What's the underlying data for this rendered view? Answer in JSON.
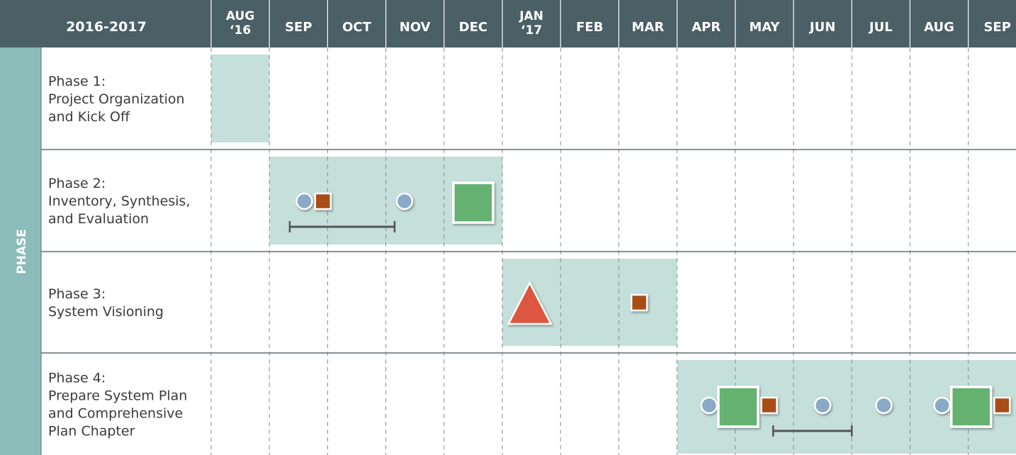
{
  "header": {
    "period_label": "2016-2017",
    "months": [
      [
        "AUG",
        "‘16"
      ],
      [
        "SEP"
      ],
      [
        "OCT"
      ],
      [
        "NOV"
      ],
      [
        "DEC"
      ],
      [
        "JAN",
        "‘17"
      ],
      [
        "FEB"
      ],
      [
        "MAR"
      ],
      [
        "APR"
      ],
      [
        "MAY"
      ],
      [
        "JUN"
      ],
      [
        "JUL"
      ],
      [
        "AUG"
      ],
      [
        "SEP"
      ]
    ]
  },
  "side_label": "PHASE",
  "phases": [
    {
      "lines": [
        "Phase 1:",
        "Project Organization",
        "and Kick Off"
      ],
      "bar": {
        "start": 0,
        "end": 1
      },
      "markers": []
    },
    {
      "lines": [
        "Phase 2:",
        "Inventory, Synthesis,",
        "and Evaluation"
      ],
      "bar": {
        "start": 1,
        "end": 5
      },
      "markers": [
        {
          "type": "circle",
          "month": 1.6
        },
        {
          "type": "small-square",
          "month": 1.92
        },
        {
          "type": "circle",
          "month": 3.32
        },
        {
          "type": "large-square",
          "month": 4.5
        },
        {
          "type": "range",
          "start": 1.35,
          "end": 3.15
        }
      ]
    },
    {
      "lines": [
        "Phase 3:",
        "System Visioning"
      ],
      "bar": {
        "start": 5,
        "end": 8
      },
      "markers": [
        {
          "type": "triangle",
          "month": 5.47
        },
        {
          "type": "small-square",
          "month": 7.35
        }
      ]
    },
    {
      "lines": [
        "Phase 4:",
        "Prepare System Plan",
        "and Comprehensive",
        "Plan Chapter"
      ],
      "bar": {
        "start": 8,
        "end": 14
      },
      "markers": [
        {
          "type": "circle",
          "month": 8.55
        },
        {
          "type": "large-square",
          "month": 9.05
        },
        {
          "type": "small-square",
          "month": 9.58
        },
        {
          "type": "circle",
          "month": 10.5
        },
        {
          "type": "circle",
          "month": 11.55
        },
        {
          "type": "circle",
          "month": 12.55
        },
        {
          "type": "large-square",
          "month": 13.05
        },
        {
          "type": "small-square",
          "month": 13.58
        },
        {
          "type": "range",
          "start": 9.65,
          "end": 11.0
        }
      ]
    }
  ],
  "legend_semantics": {
    "circle": "blue circle marker",
    "small-square": "small orange square marker",
    "large-square": "large green square marker",
    "triangle": "red triangle marker",
    "range": "date range bracket"
  },
  "colors": {
    "header_bg": "#4a5f66",
    "side_band": "#8cbcba",
    "side_label": "#ffffff",
    "bar_fill": "#c5dfdb",
    "grid_line": "#8a8a8a",
    "row_divider": "#5f6f73",
    "circle_fill": "#8aa9c6",
    "small_square_fill": "#a94d18",
    "large_square_fill": "#65b16f",
    "triangle_fill": "#dd5740",
    "range_line": "#555555",
    "phase_text": "#3b3b3b"
  }
}
